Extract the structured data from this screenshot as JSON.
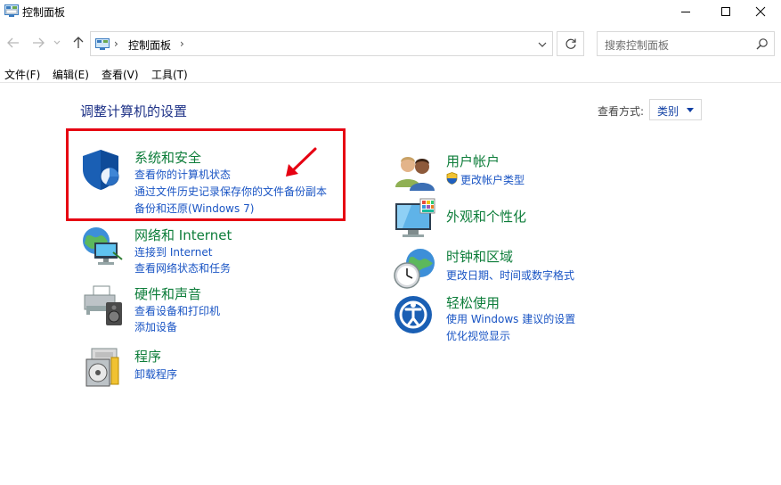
{
  "window": {
    "title": "控制面板",
    "minimize_icon": "minimize-icon",
    "maximize_icon": "maximize-icon",
    "close_icon": "close-icon"
  },
  "navigation": {
    "back_icon": "back-arrow-icon",
    "forward_icon": "forward-arrow-icon",
    "recent_icon": "chevron-down-icon",
    "up_icon": "up-arrow-icon",
    "address": {
      "separator": "›",
      "crumb": "控制面板",
      "trailing_separator": "›"
    },
    "refresh_icon": "refresh-icon",
    "search": {
      "placeholder": "搜索控制面板"
    }
  },
  "menu": {
    "items": [
      {
        "label": "文件(F)"
      },
      {
        "label": "编辑(E)"
      },
      {
        "label": "查看(V)"
      },
      {
        "label": "工具(T)"
      }
    ]
  },
  "content": {
    "heading": "调整计算机的设置",
    "view_by_label": "查看方式:",
    "view_by_value": "类别",
    "highlight_color": "#e60012",
    "categories_left": [
      {
        "title": "系统和安全",
        "icon": "shield-icon",
        "links": [
          "查看你的计算机状态",
          "通过文件历史记录保存你的文件备份副本",
          "备份和还原(Windows 7)"
        ]
      },
      {
        "title": "网络和 Internet",
        "icon": "network-globe-icon",
        "links": [
          "连接到 Internet",
          "查看网络状态和任务"
        ]
      },
      {
        "title": "硬件和声音",
        "icon": "printer-speaker-icon",
        "links": [
          "查看设备和打印机",
          "添加设备"
        ]
      },
      {
        "title": "程序",
        "icon": "programs-disk-icon",
        "links": [
          "卸载程序"
        ]
      }
    ],
    "categories_right": [
      {
        "title": "用户帐户",
        "icon": "users-icon",
        "links": [
          "更改帐户类型"
        ]
      },
      {
        "title": "外观和个性化",
        "icon": "monitor-personalize-icon",
        "links": []
      },
      {
        "title": "时钟和区域",
        "icon": "clock-globe-icon",
        "links": [
          "更改日期、时间或数字格式"
        ]
      },
      {
        "title": "轻松使用",
        "icon": "ease-of-access-icon",
        "links": [
          "使用 Windows 建议的设置",
          "优化视觉显示"
        ]
      }
    ]
  },
  "colors": {
    "category_title": "#0d7d3a",
    "link": "#1954c4",
    "heading": "#1e3287",
    "annotation_red": "#e60012"
  }
}
